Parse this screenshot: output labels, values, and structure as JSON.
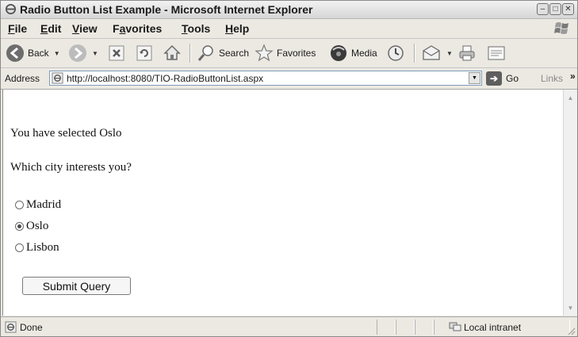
{
  "window": {
    "title": "Radio Button List Example - Microsoft Internet Explorer",
    "buttons": {
      "minimize": "–",
      "maximize": "□",
      "close": "✕"
    }
  },
  "menu": [
    {
      "underline": "F",
      "rest": "ile"
    },
    {
      "underline": "E",
      "rest": "dit"
    },
    {
      "underline": "V",
      "rest": "iew"
    },
    {
      "pre": "F",
      "underline": "a",
      "rest": "vorites"
    },
    {
      "underline": "T",
      "rest": "ools"
    },
    {
      "underline": "H",
      "rest": "elp"
    }
  ],
  "toolbar": {
    "back": "Back",
    "search": "Search",
    "favorites": "Favorites",
    "media": "Media"
  },
  "address": {
    "label": "Address",
    "url": "http://localhost:8080/TIO-RadioButtonList.aspx",
    "go": "Go",
    "links": "Links",
    "links_more": "»"
  },
  "page": {
    "message": "You have selected Oslo",
    "question": "Which city interests you?",
    "options": [
      {
        "label": "Madrid",
        "checked": false
      },
      {
        "label": "Oslo",
        "checked": true
      },
      {
        "label": "Lisbon",
        "checked": false
      }
    ],
    "submit_label": "Submit Query"
  },
  "status": {
    "text": "Done",
    "zone": "Local intranet"
  },
  "colors": {
    "chrome": "#ece9e2",
    "content_bg": "#ffffff"
  }
}
